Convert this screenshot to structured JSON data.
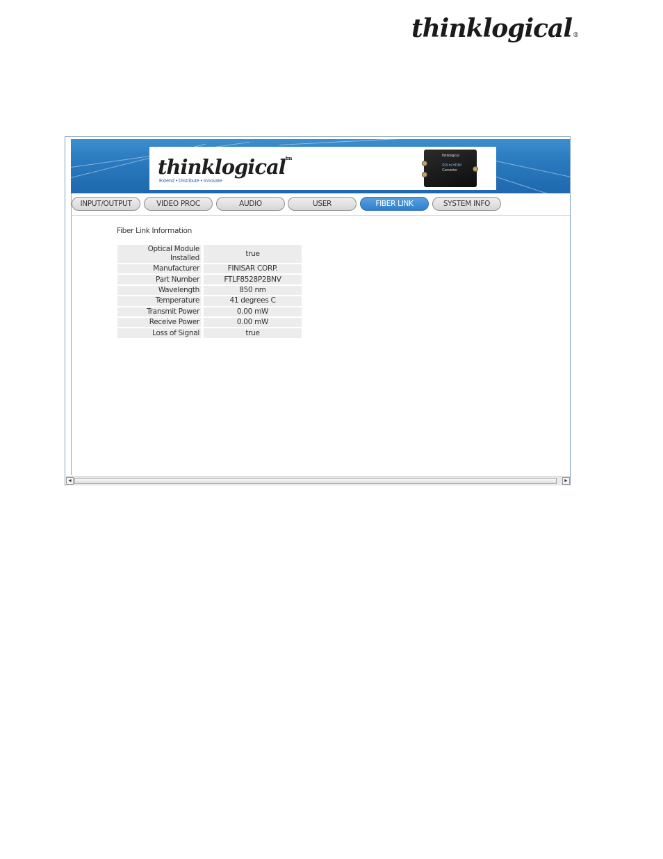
{
  "page_logo": {
    "text": "thinklogical",
    "mark": "®"
  },
  "banner": {
    "brand": "thinklogical",
    "tm": "tm",
    "tagline": "Extend • Distribute • Innovate",
    "device": {
      "brand": "thinklogical",
      "line1": "SDI to HDMI",
      "line2": "Converter"
    }
  },
  "tabs": [
    {
      "label": "INPUT/OUTPUT",
      "active": false
    },
    {
      "label": "VIDEO PROC",
      "active": false
    },
    {
      "label": "AUDIO",
      "active": false
    },
    {
      "label": "USER",
      "active": false
    },
    {
      "label": "FIBER LINK",
      "active": true
    },
    {
      "label": "SYSTEM INFO",
      "active": false
    }
  ],
  "section": {
    "title": "Fiber Link Information"
  },
  "rows": [
    {
      "label": "Optical Module Installed",
      "value": "true"
    },
    {
      "label": "Manufacturer",
      "value": "FINISAR CORP."
    },
    {
      "label": "Part Number",
      "value": "FTLF8528P2BNV"
    },
    {
      "label": "Wavelength",
      "value": "850 nm"
    },
    {
      "label": "Temperature",
      "value": "41 degrees C"
    },
    {
      "label": "Transmit Power",
      "value": "0.00 mW"
    },
    {
      "label": "Receive Power",
      "value": "0.00 mW"
    },
    {
      "label": "Loss of Signal",
      "value": "true"
    }
  ],
  "scrollbar": {
    "left_arrow": "◄",
    "right_arrow": "►"
  },
  "colors": {
    "banner_blue": "#2c7cc0",
    "active_tab": "#2f7fcc"
  }
}
